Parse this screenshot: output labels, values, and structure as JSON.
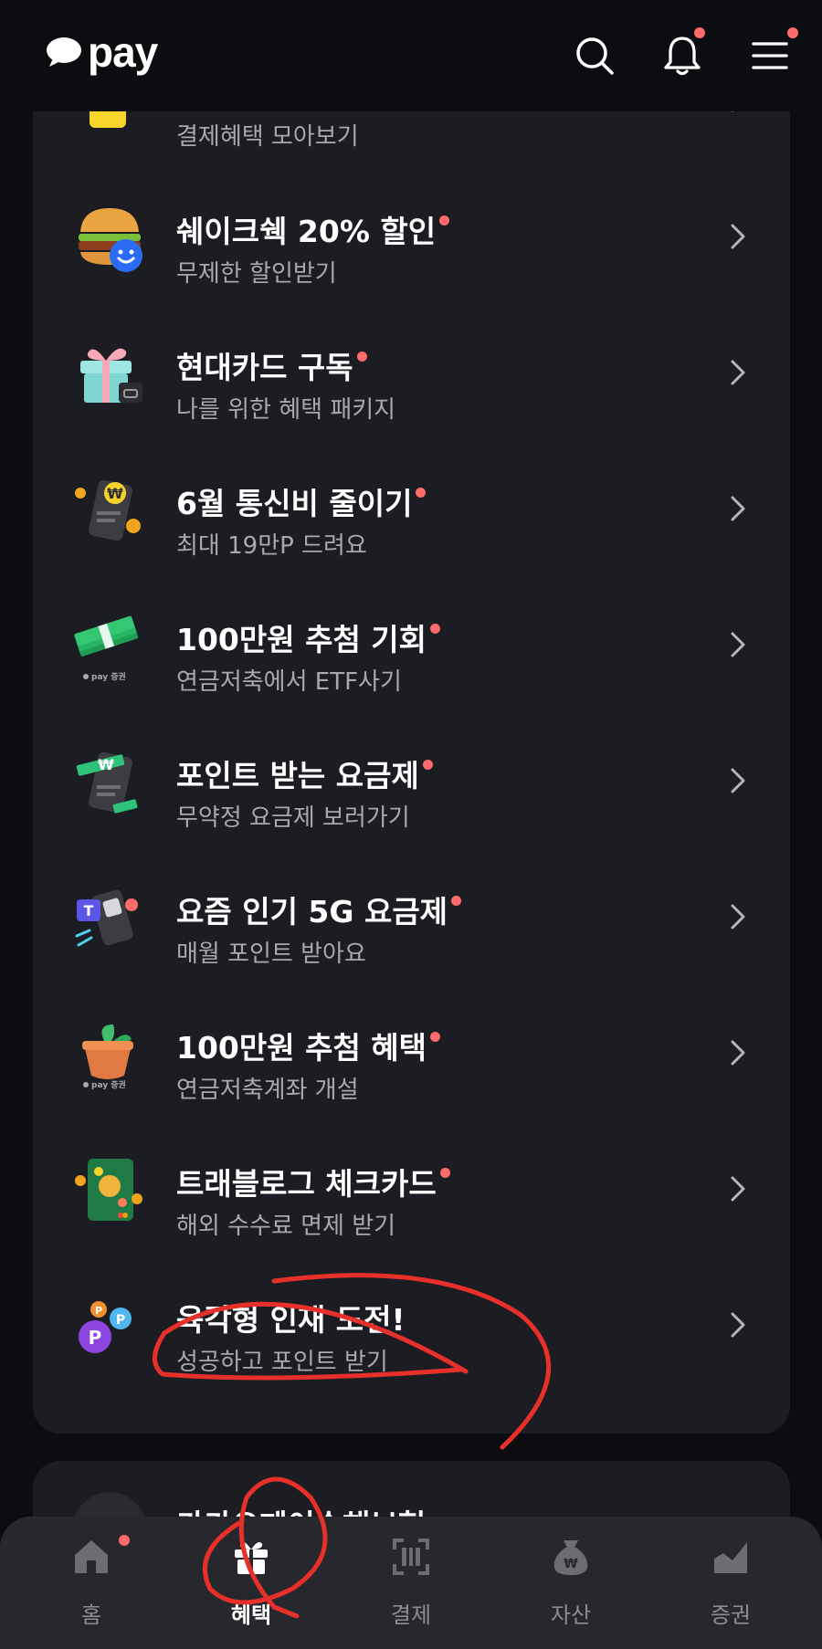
{
  "header": {
    "logo_text": "pay",
    "icons": [
      "search-icon",
      "bell-icon",
      "menu-icon"
    ],
    "notification_dots": {
      "bell": true,
      "menu": true
    }
  },
  "list": {
    "items": [
      {
        "title": "",
        "subtitle": "결제혜택 모아보기",
        "icon": "card-icon",
        "dot": false
      },
      {
        "title": "쉐이크쉑 20% 할인",
        "subtitle": "무제한 할인받기",
        "icon": "burger-icon",
        "dot": true
      },
      {
        "title": "현대카드 구독",
        "subtitle": "나를 위한 혜택 패키지",
        "icon": "gift-box-icon",
        "dot": true
      },
      {
        "title": "6월 통신비 줄이기",
        "subtitle": "최대 19만P 드려요",
        "icon": "phone-won-icon",
        "dot": true
      },
      {
        "title": "100만원 추첨 기회",
        "subtitle": "연금저축에서 ETF사기",
        "icon": "money-stack-icon",
        "dot": true,
        "badge": "pay 증권"
      },
      {
        "title": "포인트 받는 요금제",
        "subtitle": "무약정 요금제 보러가기",
        "icon": "phone-won-green-icon",
        "dot": true
      },
      {
        "title": "요즘 인기 5G 요금제",
        "subtitle": "매월 포인트 받아요",
        "icon": "phone-5g-icon",
        "dot": true
      },
      {
        "title": "100만원 추첨 혜택",
        "subtitle": "연금저축계좌 개설",
        "icon": "plant-pot-icon",
        "dot": true,
        "badge": "pay 증권"
      },
      {
        "title": "트래블로그 체크카드",
        "subtitle": "해외 수수료 면제 받기",
        "icon": "travel-card-icon",
        "dot": true
      },
      {
        "title": "육각형 인재 도전!",
        "subtitle": "성공하고 포인트 받기",
        "icon": "point-coins-icon",
        "dot": false
      }
    ]
  },
  "card2": {
    "title": "카카오페이손해보험"
  },
  "bottom_nav": {
    "items": [
      {
        "label": "홈",
        "icon": "home-icon",
        "active": false,
        "dot": true
      },
      {
        "label": "혜택",
        "icon": "gift-icon",
        "active": true,
        "dot": false
      },
      {
        "label": "결제",
        "icon": "scan-icon",
        "active": false,
        "dot": false
      },
      {
        "label": "자산",
        "icon": "money-bag-icon",
        "active": false,
        "dot": false
      },
      {
        "label": "증권",
        "icon": "chart-icon",
        "active": false,
        "dot": false
      }
    ]
  },
  "colors": {
    "background": "#0c0d10",
    "card": "#1c1d22",
    "nav": "#27282e",
    "dot": "#ff6a6a",
    "annotation": "#e8302a"
  }
}
